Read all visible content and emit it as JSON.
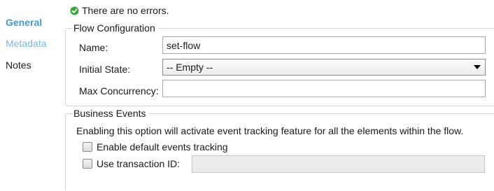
{
  "sidebar": {
    "items": [
      {
        "label": "General",
        "active": true
      },
      {
        "label": "Metadata",
        "active": false
      },
      {
        "label": "Notes",
        "active": false
      }
    ]
  },
  "status": {
    "icon": "check-circle-icon",
    "text": "There are no errors.",
    "color": "#3aa63a"
  },
  "flow_configuration": {
    "title": "Flow Configuration",
    "name": {
      "label": "Name:",
      "value": "set-flow"
    },
    "initial_state": {
      "label": "Initial State:",
      "value": "-- Empty --"
    },
    "max_concurrency": {
      "label": "Max Concurrency:",
      "value": ""
    }
  },
  "business_events": {
    "title": "Business Events",
    "description": "Enabling this option will activate event tracking feature for all the elements within the flow.",
    "enable_tracking": {
      "label": "Enable default events tracking",
      "checked": false
    },
    "transaction_id": {
      "label": "Use transaction ID:",
      "checked": false,
      "value": ""
    }
  },
  "colors": {
    "active_tab": "#4a97c9",
    "inactive_tab": "#7fb8dd",
    "group_border": "#d5d5d5"
  }
}
